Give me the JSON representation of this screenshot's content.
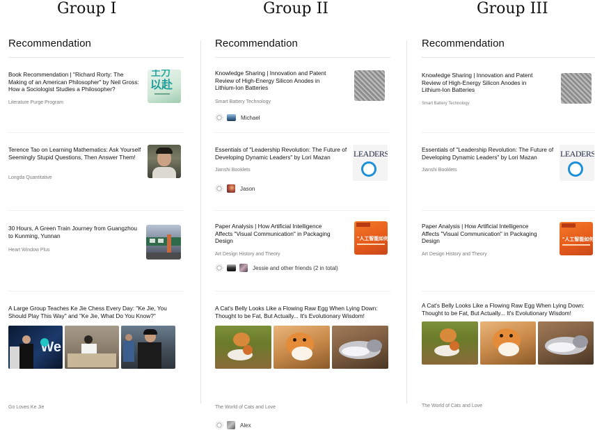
{
  "groups": [
    "Group I",
    "Group II",
    "Group III"
  ],
  "columns": [
    {
      "title": "Recommendation",
      "cards": [
        {
          "title": "Book Recommendation | \"Richard Rorty: The Making of an American Philosopher\" by Neil Gross: How a Sociologist Studies a Philosopher?",
          "source": "Literature Purge Program",
          "thumb_text": "以赴"
        },
        {
          "title": "Terence Tao on Learning Mathematics: Ask Yourself Seemingly Stupid Questions, Then Answer Them!",
          "source": "Longda Quantitative"
        },
        {
          "title": "30 Hours, A Green Train Journey from Guangzhou to Kunming, Yunnan",
          "source": "Heart Window Plus"
        },
        {
          "title": "A Large Group Teaches Ke Jie Chess Every Day: \"Ke Jie, You Should Play This Way\" and \"Ke Jie, What Do You Know?\"",
          "source": "Go Loves Ke Jie",
          "logo_text": "We"
        }
      ]
    },
    {
      "title": "Recommendation",
      "cards": [
        {
          "title": "Knowledge Sharing | Innovation and Patent Review of High-Energy Silicon Anodes in Lithium-Ion Batteries",
          "source": "Smart Battery Technology",
          "friend": "Michael"
        },
        {
          "title": "Essentials of \"Leadership Revolution: The Future of Developing Dynamic Leaders\" by Lori Mazan",
          "source": "Jianshi Booklets",
          "friend": "Jason",
          "thumb_text": "LEADERSHIP"
        },
        {
          "title": "Paper Analysis | How Artificial Intelligence Affects \"Visual Communication\" in Packaging Design",
          "source": "Art Design History and Theory",
          "friend": "Jessie and other friends (2 in total)",
          "thumb_text": "\"人工智能如何"
        },
        {
          "title": "A Cat's Belly Looks Like a Flowing Raw Egg When Lying Down: Thought to be Fat, But Actually... It's Evolutionary Wisdom!",
          "source": "The World of Cats and Love",
          "friend": "Alex"
        }
      ]
    },
    {
      "title": "Recommendation",
      "cards": [
        {
          "title": "Knowledge Sharing | Innovation and Patent Review of High-Energy Silicon Anodes in Lithium-Ion Batteries",
          "source": "Smart Battery Technology"
        },
        {
          "title": "Essentials of \"Leadership Revolution: The Future of Developing Dynamic Leaders\" by Lori Mazan",
          "source": "Jianshi Booklets",
          "thumb_text": "LEADERSHIP"
        },
        {
          "title": "Paper Analysis | How Artificial Intelligence Affects \"Visual Communication\" in Packaging Design",
          "source": "Art Design History and Theory",
          "thumb_text": "\"人工智能如何"
        },
        {
          "title": "A Cat's Belly Looks Like a Flowing Raw Egg When Lying Down: Thought to be Fat, But Actually... It's Evolutionary Wisdom!",
          "source": "The World of Cats and Love"
        }
      ]
    }
  ],
  "icons": {
    "settings": "gear-icon"
  },
  "colors": {
    "separator": "#e3e3e3",
    "source_text": "#7a7a7a"
  }
}
